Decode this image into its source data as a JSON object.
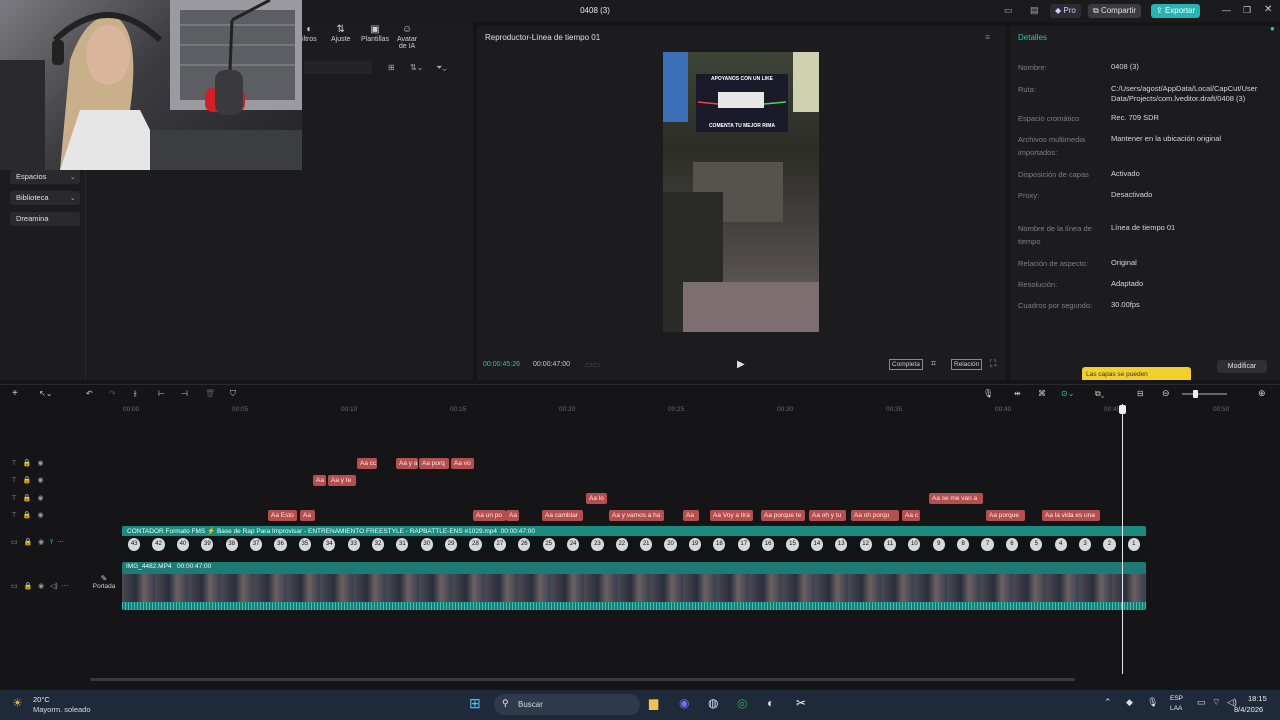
{
  "window": {
    "title": "0408 (3)",
    "pro_label": "Pro",
    "share_label": "Compartir",
    "export_label": "Exportar"
  },
  "toolbar": {
    "items": [
      "iltros",
      "Ajuste",
      "Plantillas",
      "Avatar de IA"
    ]
  },
  "left_nav": {
    "items": [
      "Espacios",
      "Biblioteca",
      "Dreamina"
    ]
  },
  "player": {
    "title": "Reproductor-Línea de tiempo 01",
    "current_time": "00:00:45:26",
    "total_time": "00:00:47:00",
    "btn_full": "Completa",
    "btn_ratio": "Relación",
    "video_text_top": "APOYANOS CON UN LIKE",
    "video_text_bottom": "COMENTA TU MEJOR RIMA"
  },
  "details": {
    "header": "Detalles",
    "rows": [
      {
        "label": "Nombre:",
        "value": "0408 (3)"
      },
      {
        "label": "Ruta:",
        "value": "C:/Users/agost/AppData/Local/CapCut/User Data/Projects/com.lveditor.draft/0408 (3)"
      },
      {
        "label": "Espacio cromático",
        "value": "Rec. 709 SDR"
      },
      {
        "label": "Archivos multimedia importados:",
        "value": "Mantener en la ubicación original"
      },
      {
        "label": "Disposición de capas",
        "value": "Activado"
      },
      {
        "label": "Proxy:",
        "value": "Desactivado"
      },
      {
        "label": "Nombre de la línea de tiempo",
        "value": "Línea de tiempo 01"
      },
      {
        "label": "Relación de aspecto:",
        "value": "Original"
      },
      {
        "label": "Resolución:",
        "value": "Adaptado"
      },
      {
        "label": "Cuadros por segundo:",
        "value": "30.00fps"
      }
    ],
    "tooltip": "Las capas se pueden",
    "modify_label": "Modificar"
  },
  "timeline": {
    "ticks": [
      "00:00",
      "00:05",
      "00:10",
      "00:15",
      "00:20",
      "00:25",
      "00:30",
      "00:35",
      "00:40",
      "00:45",
      "00:50"
    ],
    "cover_label": "Portada",
    "track_a_label": "CONTADOR Formato FMS ⚡ Base de Rap Para Improvisar - ENTRENAMIENTO FREESTYLE - RAPBATTLE-ENS #1029.mp4",
    "track_a_duration": "00:00:47:00",
    "track_b_label": "IMG_4482.MP4",
    "track_b_duration": "00:00:47:00",
    "chips_row1": [
      "Aa cc",
      "Aa y a",
      "Aa porq",
      "Aa vo"
    ],
    "chips_row2": [
      "Aa",
      "Aa y te"
    ],
    "chips_row3": [
      "Aa lo",
      "Aa se me van a"
    ],
    "chips_row4": [
      "Aa Esto",
      "Aa",
      "Aa un po",
      "Aa",
      "Aa cambiar",
      "Aa y vamos a ha",
      "Aa",
      "Aa Voy a tira",
      "Aa porque te",
      "Aa oh y tu",
      "Aa oh porqu",
      "Aa c",
      "Aa porque ",
      "Aa la vida es una"
    ],
    "counter_numbers": [
      "43",
      "42",
      "40",
      "39",
      "38",
      "37",
      "36",
      "35",
      "34",
      "33",
      "32",
      "31",
      "30",
      "29",
      "28",
      "27",
      "26",
      "25",
      "24",
      "23",
      "22",
      "21",
      "20",
      "19",
      "18",
      "17",
      "16",
      "15",
      "14",
      "13",
      "12",
      "11",
      "10",
      "9",
      "8",
      "7",
      "6",
      "5",
      "4",
      "3",
      "2",
      "1"
    ]
  },
  "taskbar": {
    "weather_temp": "20°C",
    "weather_desc": "Mayorm. soleado",
    "search_placeholder": "Buscar",
    "lang_top": "ESP",
    "lang_bottom": "LAA",
    "time": "18:15",
    "date": "8/4/2026"
  }
}
